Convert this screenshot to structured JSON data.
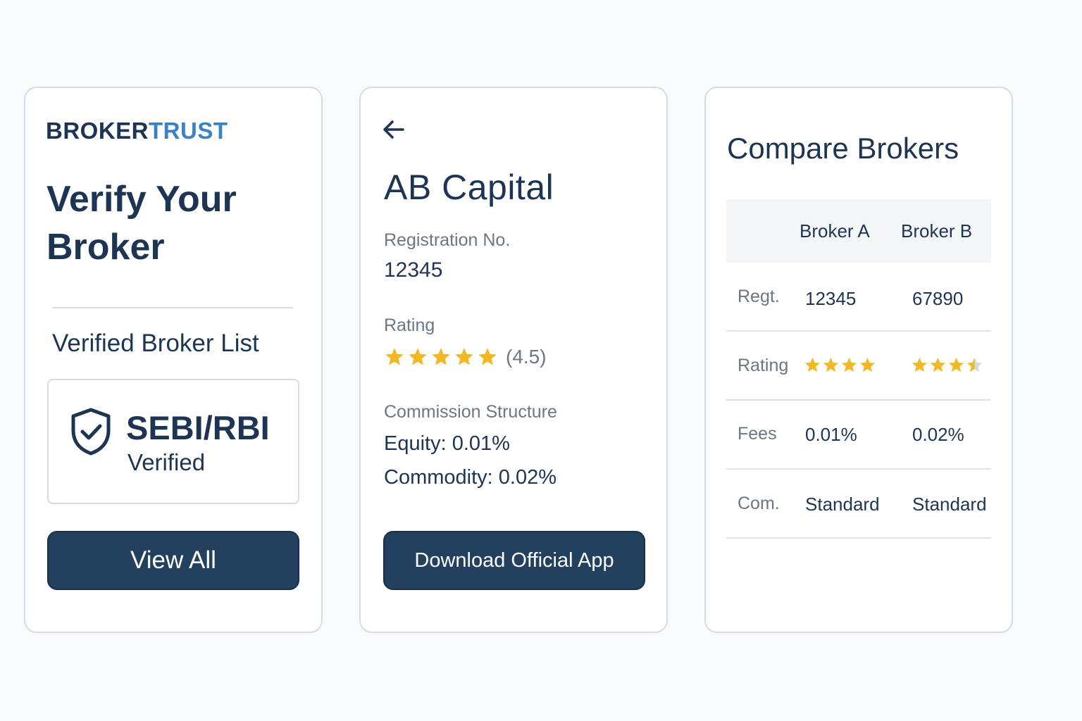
{
  "brand": {
    "part1": "BROKER",
    "part2": "TRUST"
  },
  "verify_card": {
    "title": "Verify Your Broker",
    "list_title": "Verified Broker List",
    "badge_main": "SEBI/RBI",
    "badge_sub": "Verified",
    "button_label": "View All"
  },
  "detail_card": {
    "broker_name": "AB Capital",
    "registration_label": "Registration No.",
    "registration_value": "12345",
    "rating_label": "Rating",
    "rating_stars": 5,
    "rating_value": "(4.5)",
    "commission_label": "Commission Structure",
    "commission_equity": "Equity: 0.01%",
    "commission_commodity": "Commodity: 0.02%",
    "button_label": "Download Official App"
  },
  "compare_card": {
    "title": "Compare Brokers",
    "columns": [
      "Broker A",
      "Broker B"
    ],
    "rows": [
      {
        "label": "Regt.",
        "a": "12345",
        "b": "67890"
      },
      {
        "label": "Rating",
        "a_stars": 4,
        "b_stars": 3.5
      },
      {
        "label": "Fees",
        "a": "0.01%",
        "b": "0.02%"
      },
      {
        "label": "Com.",
        "a": "Standard",
        "b": "Standard"
      }
    ]
  },
  "colors": {
    "navy": "#1d3552",
    "brand_blue": "#3b82c4",
    "button": "#23405f",
    "star": "#f2b824",
    "muted": "#6b7785"
  }
}
